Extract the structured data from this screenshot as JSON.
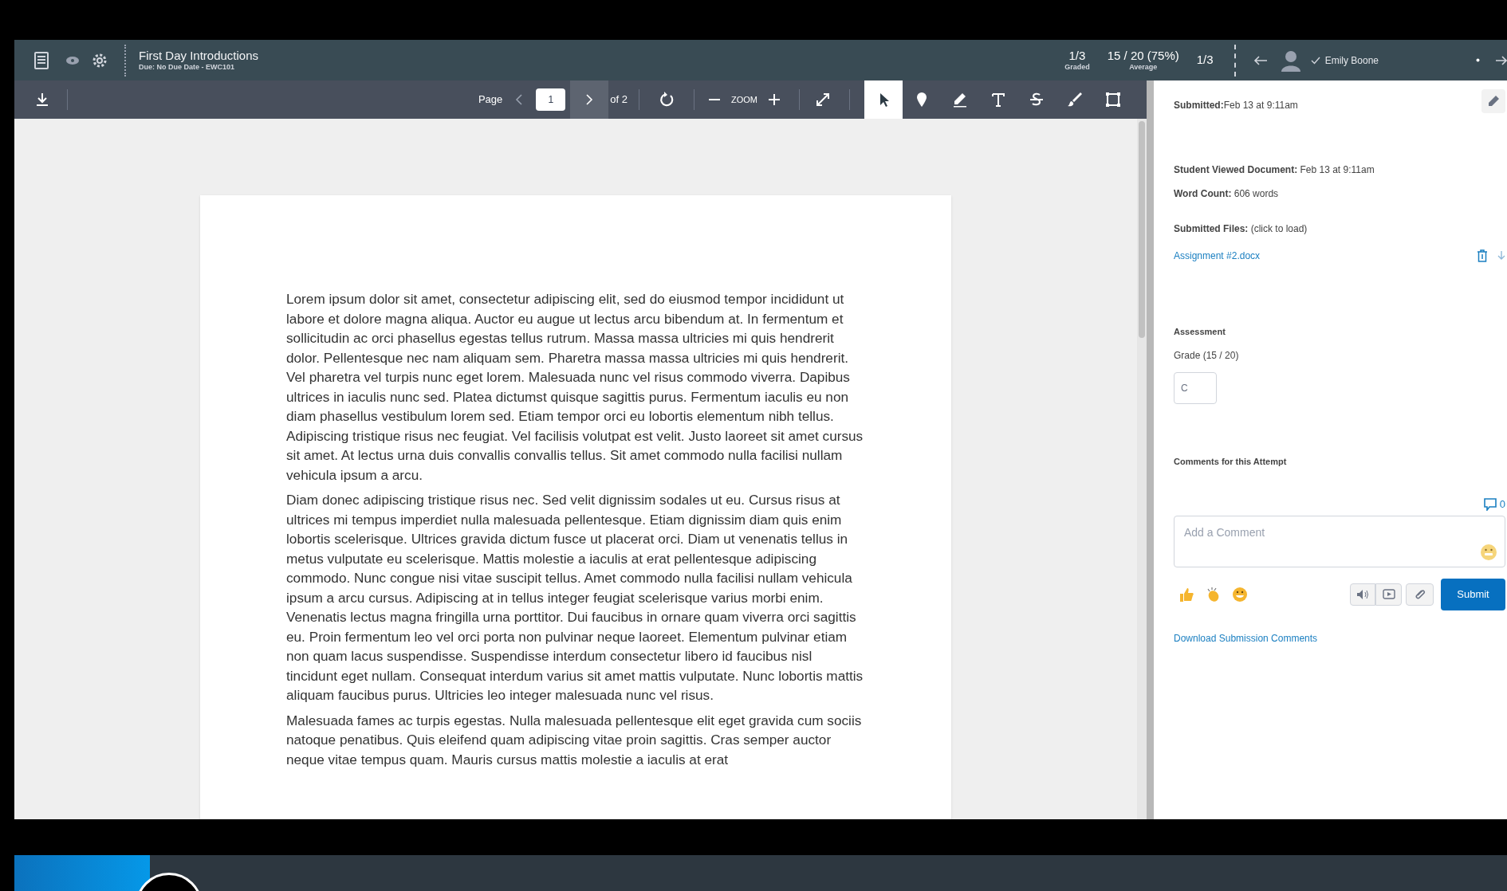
{
  "header": {
    "title": "First Day Introductions",
    "subtitle": "Due: No Due Date - EWC101",
    "stats": [
      {
        "value": "1/3",
        "label": "Graded"
      },
      {
        "value": "15 / 20 (75%)",
        "label": "Average"
      },
      {
        "value": "1/3"
      }
    ],
    "student": {
      "name": "Emily Boone",
      "submitted": true
    }
  },
  "toolbar": {
    "page_label": "Page",
    "page_value": "1",
    "page_total": "of 2",
    "zoom_label": "ZOOM",
    "tools": [
      {
        "kind": "pointer",
        "selected": true
      },
      {
        "kind": "pin",
        "selected": false
      },
      {
        "kind": "pen",
        "selected": false
      },
      {
        "kind": "text",
        "selected": false
      },
      {
        "kind": "strike",
        "selected": false
      },
      {
        "kind": "brush",
        "selected": false
      },
      {
        "kind": "area",
        "selected": false
      }
    ]
  },
  "document": {
    "paragraphs": [
      "Lorem ipsum dolor sit amet, consectetur adipiscing elit, sed do eiusmod tempor incididunt ut labore et dolore magna aliqua. Auctor eu augue ut lectus arcu bibendum at. In fermentum et sollicitudin ac orci phasellus egestas tellus rutrum. Massa massa ultricies mi quis hendrerit dolor. Pellentesque nec nam aliquam sem. Pharetra massa massa ultricies mi quis hendrerit. Vel pharetra vel turpis nunc eget lorem. Malesuada nunc vel risus commodo viverra. Dapibus ultrices in iaculis nunc sed. Platea dictumst quisque sagittis purus. Fermentum iaculis eu non diam phasellus vestibulum lorem sed. Etiam tempor orci eu lobortis elementum nibh tellus. Adipiscing tristique risus nec feugiat. Vel facilisis volutpat est velit. Justo laoreet sit amet cursus sit amet. At lectus urna duis convallis convallis tellus. Sit amet commodo nulla facilisi nullam vehicula ipsum a arcu.",
      "Diam donec adipiscing tristique risus nec. Sed velit dignissim sodales ut eu. Cursus risus at ultrices mi tempus imperdiet nulla malesuada pellentesque. Etiam dignissim diam quis enim lobortis scelerisque. Ultrices gravida dictum fusce ut placerat orci. Diam ut venenatis tellus in metus vulputate eu scelerisque. Mattis molestie a iaculis at erat pellentesque adipiscing commodo. Nunc congue nisi vitae suscipit tellus. Amet commodo nulla facilisi nullam vehicula ipsum a arcu cursus. Adipiscing at in tellus integer feugiat scelerisque varius morbi enim. Venenatis lectus magna fringilla urna porttitor. Dui faucibus in ornare quam viverra orci sagittis eu. Proin fermentum leo vel orci porta non pulvinar neque laoreet. Elementum pulvinar etiam non quam lacus suspendisse. Suspendisse interdum consectetur libero id faucibus nisl tincidunt eget nullam. Consequat interdum varius sit amet mattis vulputate. Nunc lobortis mattis aliquam faucibus purus. Ultricies leo integer malesuada nunc vel risus.",
      "Malesuada fames ac turpis egestas. Nulla malesuada pellentesque elit eget gravida cum sociis natoque penatibus. Quis eleifend quam adipiscing vitae proin sagittis. Cras semper auctor neque vitae tempus quam. Mauris cursus mattis molestie a iaculis at erat"
    ]
  },
  "panel": {
    "submitted": "**Submitted:**Feb 13 at 9:11am",
    "viewed": "**Student Viewed Document:** Feb 13 at 9:11am",
    "word_count": "**Word Count:** 606 words",
    "files_label": "**Submitted Files:** (click to load)",
    "file_link": "Assignment #2.docx",
    "assessment": "Assessment",
    "grade_label": "Grade (15 / 20)",
    "grade_value": "C",
    "comments_heading": "Comments for this Attempt",
    "comment_count": "0",
    "comment_placeholder": "Add a Comment",
    "submit": "Submit",
    "download_link": "Download Submission Comments"
  }
}
